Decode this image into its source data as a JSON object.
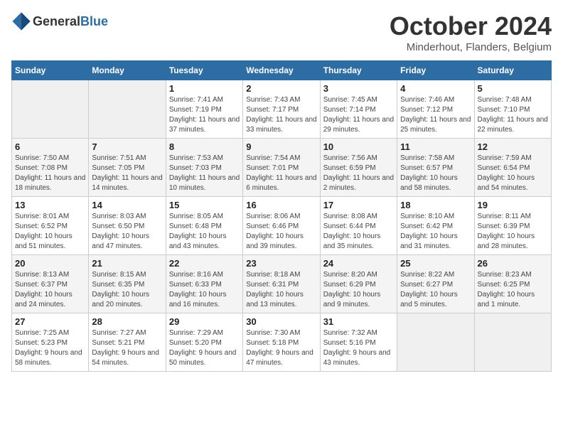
{
  "header": {
    "logo_general": "General",
    "logo_blue": "Blue",
    "title": "October 2024",
    "subtitle": "Minderhout, Flanders, Belgium"
  },
  "weekdays": [
    "Sunday",
    "Monday",
    "Tuesday",
    "Wednesday",
    "Thursday",
    "Friday",
    "Saturday"
  ],
  "weeks": [
    [
      {
        "day": "",
        "sunrise": "",
        "sunset": "",
        "daylight": ""
      },
      {
        "day": "",
        "sunrise": "",
        "sunset": "",
        "daylight": ""
      },
      {
        "day": "1",
        "sunrise": "Sunrise: 7:41 AM",
        "sunset": "Sunset: 7:19 PM",
        "daylight": "Daylight: 11 hours and 37 minutes."
      },
      {
        "day": "2",
        "sunrise": "Sunrise: 7:43 AM",
        "sunset": "Sunset: 7:17 PM",
        "daylight": "Daylight: 11 hours and 33 minutes."
      },
      {
        "day": "3",
        "sunrise": "Sunrise: 7:45 AM",
        "sunset": "Sunset: 7:14 PM",
        "daylight": "Daylight: 11 hours and 29 minutes."
      },
      {
        "day": "4",
        "sunrise": "Sunrise: 7:46 AM",
        "sunset": "Sunset: 7:12 PM",
        "daylight": "Daylight: 11 hours and 25 minutes."
      },
      {
        "day": "5",
        "sunrise": "Sunrise: 7:48 AM",
        "sunset": "Sunset: 7:10 PM",
        "daylight": "Daylight: 11 hours and 22 minutes."
      }
    ],
    [
      {
        "day": "6",
        "sunrise": "Sunrise: 7:50 AM",
        "sunset": "Sunset: 7:08 PM",
        "daylight": "Daylight: 11 hours and 18 minutes."
      },
      {
        "day": "7",
        "sunrise": "Sunrise: 7:51 AM",
        "sunset": "Sunset: 7:05 PM",
        "daylight": "Daylight: 11 hours and 14 minutes."
      },
      {
        "day": "8",
        "sunrise": "Sunrise: 7:53 AM",
        "sunset": "Sunset: 7:03 PM",
        "daylight": "Daylight: 11 hours and 10 minutes."
      },
      {
        "day": "9",
        "sunrise": "Sunrise: 7:54 AM",
        "sunset": "Sunset: 7:01 PM",
        "daylight": "Daylight: 11 hours and 6 minutes."
      },
      {
        "day": "10",
        "sunrise": "Sunrise: 7:56 AM",
        "sunset": "Sunset: 6:59 PM",
        "daylight": "Daylight: 11 hours and 2 minutes."
      },
      {
        "day": "11",
        "sunrise": "Sunrise: 7:58 AM",
        "sunset": "Sunset: 6:57 PM",
        "daylight": "Daylight: 10 hours and 58 minutes."
      },
      {
        "day": "12",
        "sunrise": "Sunrise: 7:59 AM",
        "sunset": "Sunset: 6:54 PM",
        "daylight": "Daylight: 10 hours and 54 minutes."
      }
    ],
    [
      {
        "day": "13",
        "sunrise": "Sunrise: 8:01 AM",
        "sunset": "Sunset: 6:52 PM",
        "daylight": "Daylight: 10 hours and 51 minutes."
      },
      {
        "day": "14",
        "sunrise": "Sunrise: 8:03 AM",
        "sunset": "Sunset: 6:50 PM",
        "daylight": "Daylight: 10 hours and 47 minutes."
      },
      {
        "day": "15",
        "sunrise": "Sunrise: 8:05 AM",
        "sunset": "Sunset: 6:48 PM",
        "daylight": "Daylight: 10 hours and 43 minutes."
      },
      {
        "day": "16",
        "sunrise": "Sunrise: 8:06 AM",
        "sunset": "Sunset: 6:46 PM",
        "daylight": "Daylight: 10 hours and 39 minutes."
      },
      {
        "day": "17",
        "sunrise": "Sunrise: 8:08 AM",
        "sunset": "Sunset: 6:44 PM",
        "daylight": "Daylight: 10 hours and 35 minutes."
      },
      {
        "day": "18",
        "sunrise": "Sunrise: 8:10 AM",
        "sunset": "Sunset: 6:42 PM",
        "daylight": "Daylight: 10 hours and 31 minutes."
      },
      {
        "day": "19",
        "sunrise": "Sunrise: 8:11 AM",
        "sunset": "Sunset: 6:39 PM",
        "daylight": "Daylight: 10 hours and 28 minutes."
      }
    ],
    [
      {
        "day": "20",
        "sunrise": "Sunrise: 8:13 AM",
        "sunset": "Sunset: 6:37 PM",
        "daylight": "Daylight: 10 hours and 24 minutes."
      },
      {
        "day": "21",
        "sunrise": "Sunrise: 8:15 AM",
        "sunset": "Sunset: 6:35 PM",
        "daylight": "Daylight: 10 hours and 20 minutes."
      },
      {
        "day": "22",
        "sunrise": "Sunrise: 8:16 AM",
        "sunset": "Sunset: 6:33 PM",
        "daylight": "Daylight: 10 hours and 16 minutes."
      },
      {
        "day": "23",
        "sunrise": "Sunrise: 8:18 AM",
        "sunset": "Sunset: 6:31 PM",
        "daylight": "Daylight: 10 hours and 13 minutes."
      },
      {
        "day": "24",
        "sunrise": "Sunrise: 8:20 AM",
        "sunset": "Sunset: 6:29 PM",
        "daylight": "Daylight: 10 hours and 9 minutes."
      },
      {
        "day": "25",
        "sunrise": "Sunrise: 8:22 AM",
        "sunset": "Sunset: 6:27 PM",
        "daylight": "Daylight: 10 hours and 5 minutes."
      },
      {
        "day": "26",
        "sunrise": "Sunrise: 8:23 AM",
        "sunset": "Sunset: 6:25 PM",
        "daylight": "Daylight: 10 hours and 1 minute."
      }
    ],
    [
      {
        "day": "27",
        "sunrise": "Sunrise: 7:25 AM",
        "sunset": "Sunset: 5:23 PM",
        "daylight": "Daylight: 9 hours and 58 minutes."
      },
      {
        "day": "28",
        "sunrise": "Sunrise: 7:27 AM",
        "sunset": "Sunset: 5:21 PM",
        "daylight": "Daylight: 9 hours and 54 minutes."
      },
      {
        "day": "29",
        "sunrise": "Sunrise: 7:29 AM",
        "sunset": "Sunset: 5:20 PM",
        "daylight": "Daylight: 9 hours and 50 minutes."
      },
      {
        "day": "30",
        "sunrise": "Sunrise: 7:30 AM",
        "sunset": "Sunset: 5:18 PM",
        "daylight": "Daylight: 9 hours and 47 minutes."
      },
      {
        "day": "31",
        "sunrise": "Sunrise: 7:32 AM",
        "sunset": "Sunset: 5:16 PM",
        "daylight": "Daylight: 9 hours and 43 minutes."
      },
      {
        "day": "",
        "sunrise": "",
        "sunset": "",
        "daylight": ""
      },
      {
        "day": "",
        "sunrise": "",
        "sunset": "",
        "daylight": ""
      }
    ]
  ]
}
